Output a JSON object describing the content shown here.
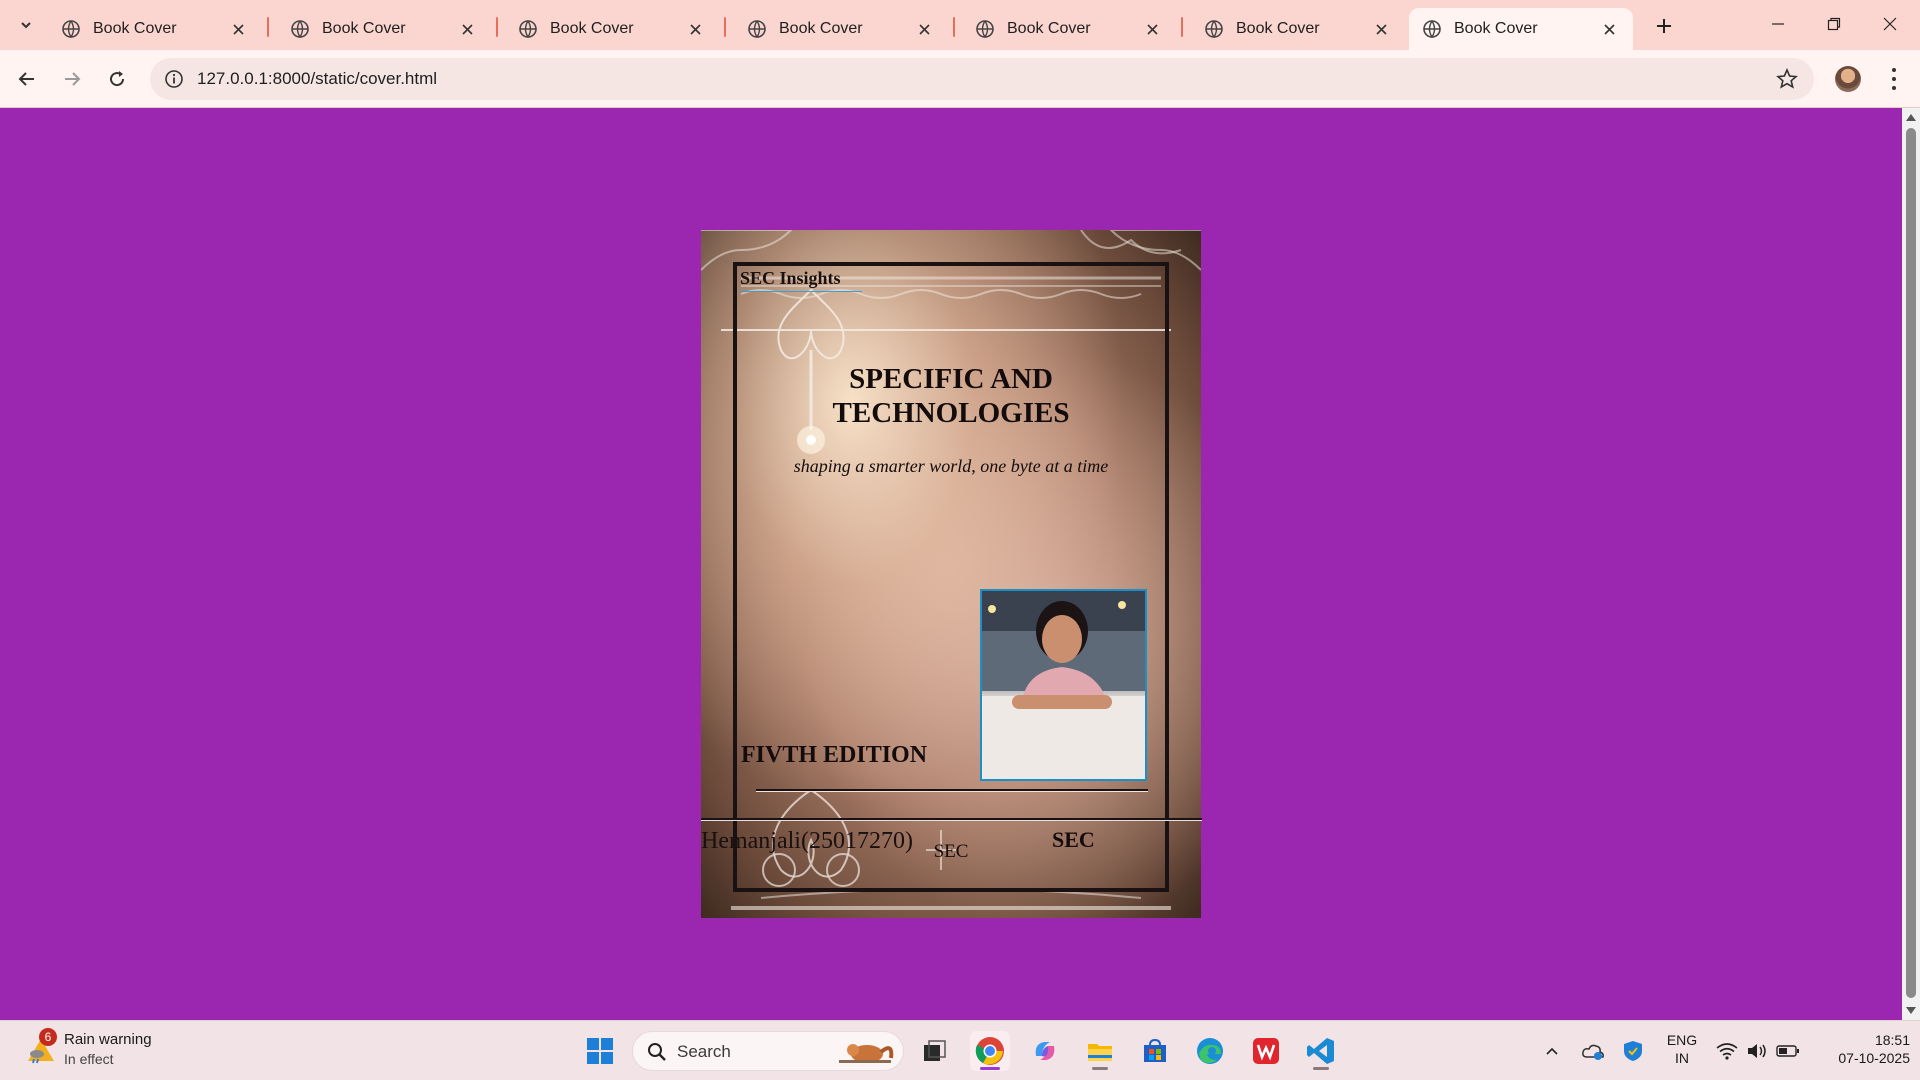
{
  "browser": {
    "tabs": [
      {
        "title": "Book Cover",
        "active": false
      },
      {
        "title": "Book Cover",
        "active": false
      },
      {
        "title": "Book Cover",
        "active": false
      },
      {
        "title": "Book Cover",
        "active": false
      },
      {
        "title": "Book Cover",
        "active": false
      },
      {
        "title": "Book Cover",
        "active": false
      },
      {
        "title": "Book Cover",
        "active": true
      }
    ],
    "url": "127.0.0.1:8000/static/cover.html",
    "colors": {
      "tabbar": "#fbd6d0",
      "toolbar": "#fff4f1",
      "tab_separator": "#e86e5b"
    }
  },
  "page": {
    "background": "#9b27b0",
    "cover": {
      "brand": "SEC Insights",
      "title": "SPECIFIC AND TECHNOLOGIES",
      "tagline": "shaping a smarter world, one byte at a time",
      "edition": "FIVTH EDITION",
      "author": "Hemanjali(25017270)",
      "publisher": "SEC"
    },
    "footer": "SEC"
  },
  "taskbar": {
    "weather": {
      "badge": "6",
      "title": "Rain warning",
      "subtitle": "In effect"
    },
    "search_placeholder": "Search",
    "apps": [
      "start-icon",
      "search-icon",
      "task-view-icon",
      "chrome-icon",
      "copilot-icon",
      "file-explorer-icon",
      "store-icon",
      "edge-icon",
      "wps-icon",
      "vscode-icon"
    ],
    "tray": {
      "lang_line1": "ENG",
      "lang_line2": "IN",
      "time": "18:51",
      "date": "07-10-2025"
    }
  }
}
